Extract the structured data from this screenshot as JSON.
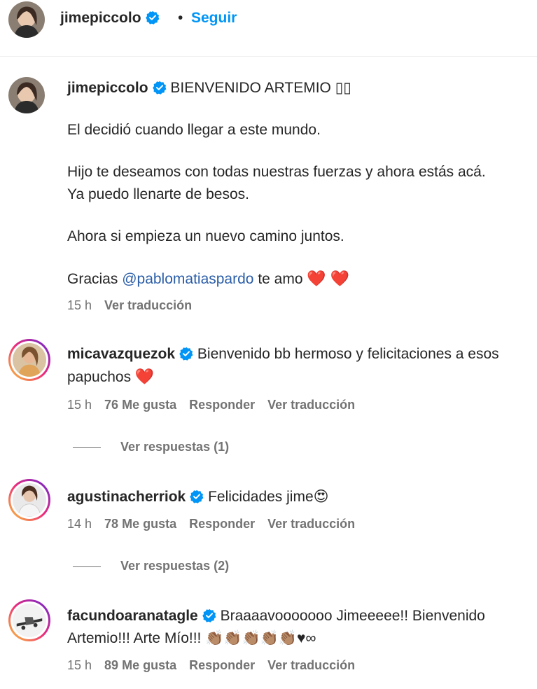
{
  "header": {
    "username": "jimepiccolo",
    "separator": "•",
    "follow_label": "Seguir"
  },
  "post": {
    "username": "jimepiccolo",
    "caption_title": "BIENVENIDO ARTEMIO ▯▯",
    "line1": "El decidió cuando llegar a este mundo.",
    "line2": "Hijo te deseamos con todas nuestras fuerzas y ahora estás acá.",
    "line3": "Ya puedo llenarte de besos.",
    "line4": "Ahora si empieza un nuevo camino juntos.",
    "line5_prefix": "Gracias",
    "mention": "@pablomatiaspardo",
    "line5_suffix": "te amo",
    "hearts": "❤️ ❤️",
    "time": "15 h",
    "translate": "Ver traducción"
  },
  "comments": [
    {
      "username": "micavazquezok",
      "text": "Bienvenido bb hermoso y felicitaciones a esos papuchos",
      "emoji": "❤️",
      "time": "15 h",
      "likes": "76 Me gusta",
      "reply": "Responder",
      "translate": "Ver traducción",
      "replies": "Ver respuestas (1)"
    },
    {
      "username": "agustinacherriok",
      "text": "Felicidades jime",
      "emoji": "😍",
      "time": "14 h",
      "likes": "78 Me gusta",
      "reply": "Responder",
      "translate": "Ver traducción",
      "replies": "Ver respuestas (2)"
    },
    {
      "username": "facundoaranatagle",
      "text": "Braaaavooooooo Jimeeeee!! Bienvenido Artemio!!! Arte Mío!!!",
      "emoji": "👏🏽👏🏽👏🏽👏🏽👏🏽♥∞",
      "time": "15 h",
      "likes": "89 Me gusta",
      "reply": "Responder",
      "translate": "Ver traducción"
    }
  ],
  "colors": {
    "accent": "#0095f6",
    "verified": "#0095f6",
    "heart": "#ed1c24",
    "muted": "#737373"
  },
  "icons": [
    "verified-badge-icon",
    "heart-emoji-icon"
  ]
}
